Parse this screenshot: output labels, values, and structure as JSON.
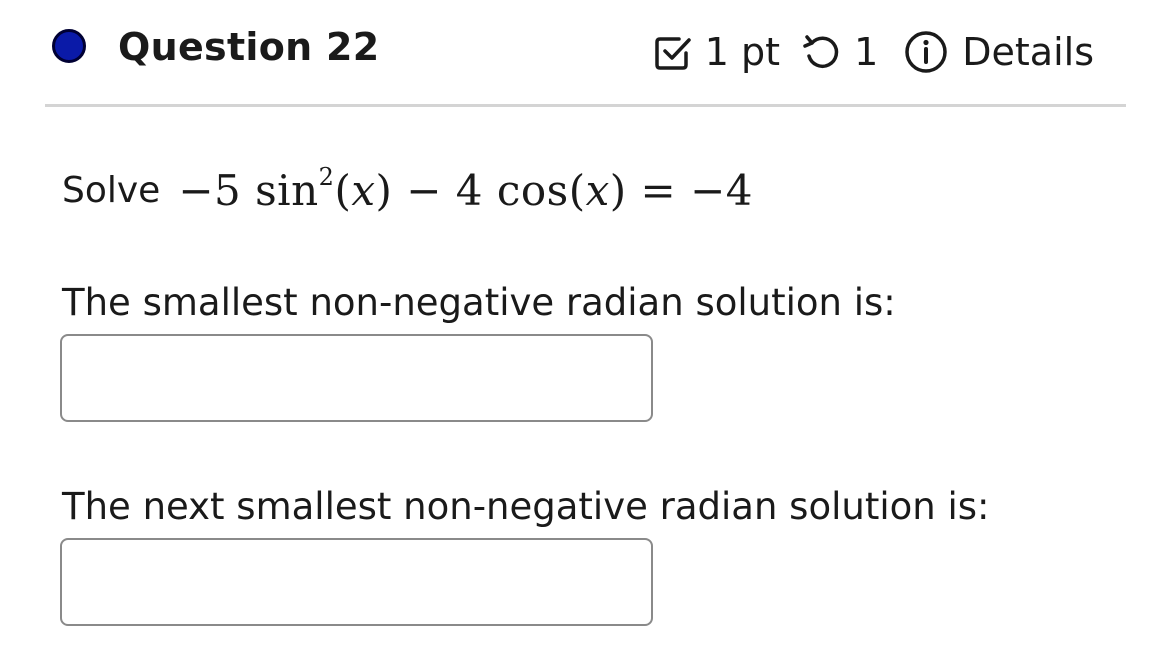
{
  "question": {
    "title": "Question 22",
    "points_label": "1 pt",
    "retry_count": "1",
    "details_label": "Details",
    "status_color": "#0a1aa8"
  },
  "icons": {
    "status": "status-dot-icon",
    "points": "checkbox-icon",
    "retry": "retry-icon",
    "details": "info-icon"
  },
  "problem": {
    "solve_label": "Solve",
    "equation_part1": "−5 sin",
    "equation_exponent": "2",
    "equation_part2": "(𝑥) − 4 cos(𝑥) = −4"
  },
  "answers": [
    {
      "prompt": "The smallest non-negative radian solution is:",
      "value": "",
      "placeholder": ""
    },
    {
      "prompt": "The next smallest non-negative radian solution is:",
      "value": "",
      "placeholder": ""
    }
  ]
}
